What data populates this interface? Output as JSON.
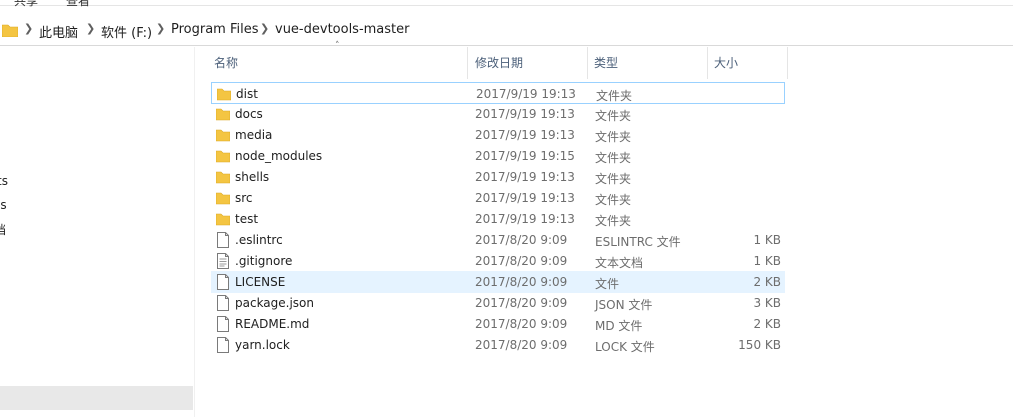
{
  "ribbon": {
    "tabs": [
      "共享",
      "查看"
    ]
  },
  "address": {
    "folder_icon": "folder-icon",
    "segments": [
      "此电脑",
      "软件 (F:)",
      "Program Files",
      "vue-devtools-master"
    ]
  },
  "nav": {
    "items": [
      "ts",
      "ls",
      "档"
    ]
  },
  "columns": {
    "name": "名称",
    "date": "修改日期",
    "type": "类型",
    "size": "大小"
  },
  "files": [
    {
      "name": "dist",
      "date": "2017/9/19 19:13",
      "type": "文件夹",
      "size": "",
      "icon": "folder-icon"
    },
    {
      "name": "docs",
      "date": "2017/9/19 19:13",
      "type": "文件夹",
      "size": "",
      "icon": "folder-icon"
    },
    {
      "name": "media",
      "date": "2017/9/19 19:13",
      "type": "文件夹",
      "size": "",
      "icon": "folder-icon"
    },
    {
      "name": "node_modules",
      "date": "2017/9/19 19:15",
      "type": "文件夹",
      "size": "",
      "icon": "folder-icon"
    },
    {
      "name": "shells",
      "date": "2017/9/19 19:13",
      "type": "文件夹",
      "size": "",
      "icon": "folder-icon"
    },
    {
      "name": "src",
      "date": "2017/9/19 19:13",
      "type": "文件夹",
      "size": "",
      "icon": "folder-icon"
    },
    {
      "name": "test",
      "date": "2017/9/19 19:13",
      "type": "文件夹",
      "size": "",
      "icon": "folder-icon"
    },
    {
      "name": ".eslintrc",
      "date": "2017/8/20 9:09",
      "type": "ESLINTRC 文件",
      "size": "1 KB",
      "icon": "file-icon"
    },
    {
      "name": ".gitignore",
      "date": "2017/8/20 9:09",
      "type": "文本文档",
      "size": "1 KB",
      "icon": "text-file-icon"
    },
    {
      "name": "LICENSE",
      "date": "2017/8/20 9:09",
      "type": "文件",
      "size": "2 KB",
      "icon": "file-icon"
    },
    {
      "name": "package.json",
      "date": "2017/8/20 9:09",
      "type": "JSON 文件",
      "size": "3 KB",
      "icon": "file-icon"
    },
    {
      "name": "README.md",
      "date": "2017/8/20 9:09",
      "type": "MD 文件",
      "size": "2 KB",
      "icon": "file-icon"
    },
    {
      "name": "yarn.lock",
      "date": "2017/8/20 9:09",
      "type": "LOCK 文件",
      "size": "150 KB",
      "icon": "file-icon"
    }
  ],
  "colors": {
    "folder": "#f4c542",
    "selection": "#e5f3ff",
    "focus_border": "#99d1ff"
  }
}
